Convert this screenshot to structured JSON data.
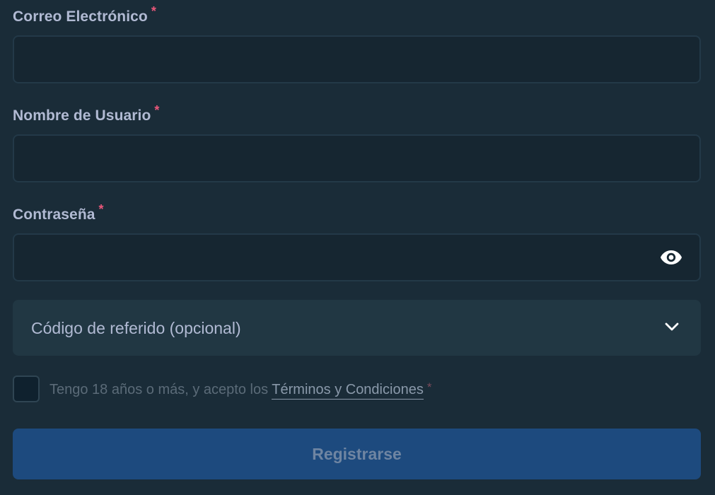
{
  "form": {
    "email": {
      "label": "Correo Electrónico",
      "required_mark": "*",
      "value": "",
      "placeholder": ""
    },
    "username": {
      "label": "Nombre de Usuario",
      "required_mark": "*",
      "value": "",
      "placeholder": ""
    },
    "password": {
      "label": "Contraseña",
      "required_mark": "*",
      "value": "",
      "placeholder": "",
      "toggle_icon": "eye-icon"
    },
    "referral": {
      "label": "Código de referido (opcional)",
      "icon": "chevron-down-icon"
    },
    "terms": {
      "checked": false,
      "text": "Tengo 18 años o más, y acepto los ",
      "link_text": "Términos y Condiciones",
      "required_mark": "*"
    },
    "submit": {
      "label": "Registrarse"
    }
  },
  "colors": {
    "background": "#1a2c38",
    "input_background": "#162631",
    "required": "#e9577a",
    "button": "#1d4a7e"
  }
}
